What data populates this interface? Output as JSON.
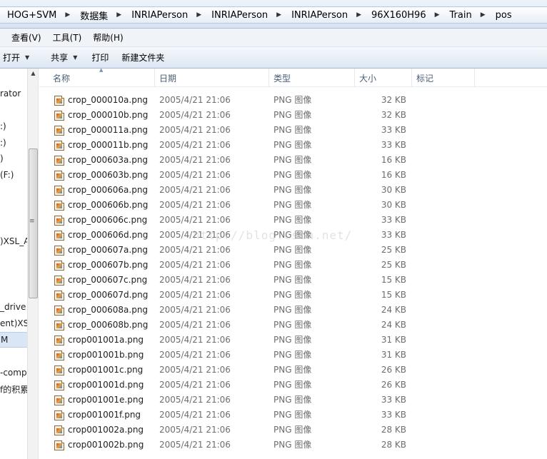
{
  "breadcrumbs": [
    "HOG+SVM",
    "数据集",
    "INRIAPerson",
    "INRIAPerson",
    "INRIAPerson",
    "96X160H96",
    "Train",
    "pos"
  ],
  "menu": [
    "查看(V)",
    "工具(T)",
    "帮助(H)"
  ],
  "toolbar": {
    "open_label": "打开",
    "share_label": "共享",
    "print_label": "打印",
    "new_folder_label": "新建文件夹"
  },
  "nav": {
    "items": [
      "rator",
      ":)",
      ":)",
      ")",
      " (F:)",
      ")XSL_A",
      "_drive",
      "ent)XSL",
      "M",
      "-comp",
      "f的积累"
    ]
  },
  "columns": {
    "name": "名称",
    "date": "日期",
    "type": "类型",
    "size": "大小",
    "tags": "标记"
  },
  "files": [
    {
      "name": "crop_000010a.png",
      "date": "2005/4/21 21:06",
      "type": "PNG 图像",
      "size": "32 KB"
    },
    {
      "name": "crop_000010b.png",
      "date": "2005/4/21 21:06",
      "type": "PNG 图像",
      "size": "32 KB"
    },
    {
      "name": "crop_000011a.png",
      "date": "2005/4/21 21:06",
      "type": "PNG 图像",
      "size": "33 KB"
    },
    {
      "name": "crop_000011b.png",
      "date": "2005/4/21 21:06",
      "type": "PNG 图像",
      "size": "33 KB"
    },
    {
      "name": "crop_000603a.png",
      "date": "2005/4/21 21:06",
      "type": "PNG 图像",
      "size": "16 KB"
    },
    {
      "name": "crop_000603b.png",
      "date": "2005/4/21 21:06",
      "type": "PNG 图像",
      "size": "16 KB"
    },
    {
      "name": "crop_000606a.png",
      "date": "2005/4/21 21:06",
      "type": "PNG 图像",
      "size": "30 KB"
    },
    {
      "name": "crop_000606b.png",
      "date": "2005/4/21 21:06",
      "type": "PNG 图像",
      "size": "30 KB"
    },
    {
      "name": "crop_000606c.png",
      "date": "2005/4/21 21:06",
      "type": "PNG 图像",
      "size": "33 KB"
    },
    {
      "name": "crop_000606d.png",
      "date": "2005/4/21 21:06",
      "type": "PNG 图像",
      "size": "33 KB"
    },
    {
      "name": "crop_000607a.png",
      "date": "2005/4/21 21:06",
      "type": "PNG 图像",
      "size": "25 KB"
    },
    {
      "name": "crop_000607b.png",
      "date": "2005/4/21 21:06",
      "type": "PNG 图像",
      "size": "25 KB"
    },
    {
      "name": "crop_000607c.png",
      "date": "2005/4/21 21:06",
      "type": "PNG 图像",
      "size": "15 KB"
    },
    {
      "name": "crop_000607d.png",
      "date": "2005/4/21 21:06",
      "type": "PNG 图像",
      "size": "15 KB"
    },
    {
      "name": "crop_000608a.png",
      "date": "2005/4/21 21:06",
      "type": "PNG 图像",
      "size": "24 KB"
    },
    {
      "name": "crop_000608b.png",
      "date": "2005/4/21 21:06",
      "type": "PNG 图像",
      "size": "24 KB"
    },
    {
      "name": "crop001001a.png",
      "date": "2005/4/21 21:06",
      "type": "PNG 图像",
      "size": "31 KB"
    },
    {
      "name": "crop001001b.png",
      "date": "2005/4/21 21:06",
      "type": "PNG 图像",
      "size": "31 KB"
    },
    {
      "name": "crop001001c.png",
      "date": "2005/4/21 21:06",
      "type": "PNG 图像",
      "size": "26 KB"
    },
    {
      "name": "crop001001d.png",
      "date": "2005/4/21 21:06",
      "type": "PNG 图像",
      "size": "26 KB"
    },
    {
      "name": "crop001001e.png",
      "date": "2005/4/21 21:06",
      "type": "PNG 图像",
      "size": "33 KB"
    },
    {
      "name": "crop001001f.png",
      "date": "2005/4/21 21:06",
      "type": "PNG 图像",
      "size": "33 KB"
    },
    {
      "name": "crop001002a.png",
      "date": "2005/4/21 21:06",
      "type": "PNG 图像",
      "size": "28 KB"
    },
    {
      "name": "crop001002b.png",
      "date": "2005/4/21 21:06",
      "type": "PNG 图像",
      "size": "28 KB"
    }
  ],
  "watermark": "http://blog.csdn.net/"
}
